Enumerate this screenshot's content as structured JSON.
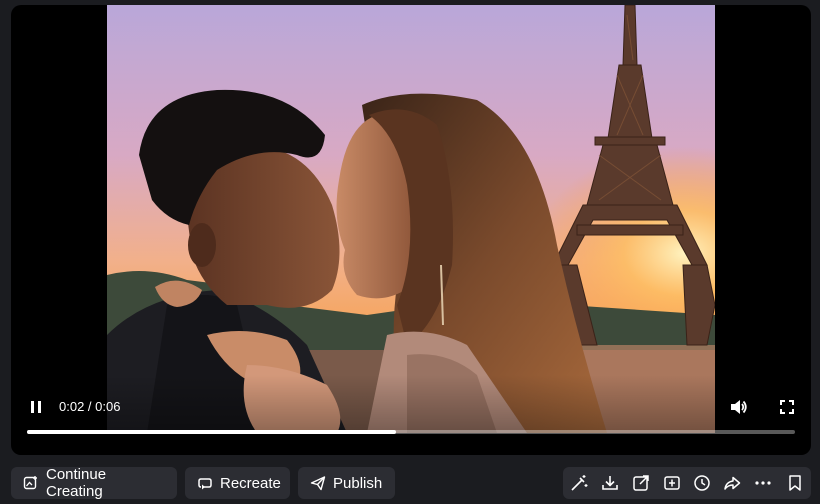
{
  "player": {
    "current_time": "0:02",
    "duration": "0:06",
    "time_separator": " / ",
    "progress": 0.48,
    "state": "playing",
    "icons": {
      "pause": "pause-icon",
      "volume": "volume-icon",
      "fullscreen": "fullscreen-icon"
    }
  },
  "actions": {
    "continue_label": "Continue Creating",
    "recreate_label": "Recreate",
    "publish_label": "Publish"
  },
  "toolbar_icons": [
    "magic-edit-icon",
    "download-icon",
    "open-external-icon",
    "crop-icon",
    "history-icon",
    "share-icon",
    "more-icon",
    "bookmark-icon"
  ],
  "colors": {
    "page_bg": "#1b1c20",
    "button_bg": "#2c2d33",
    "text": "#ffffff"
  }
}
